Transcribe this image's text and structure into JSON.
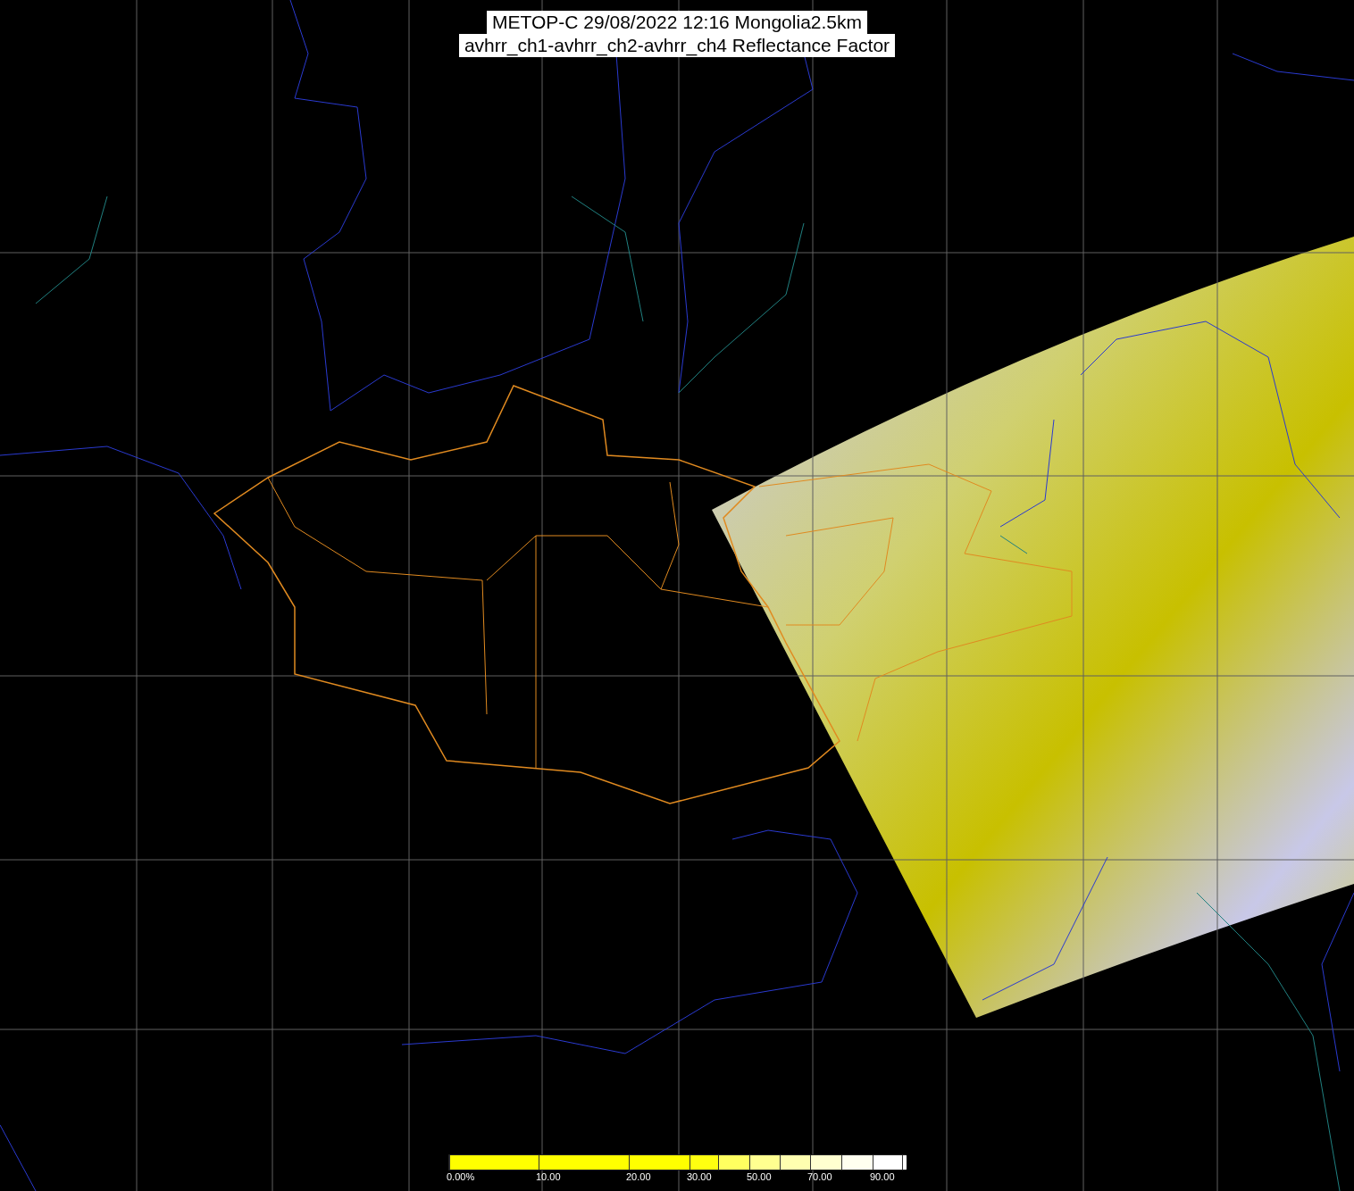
{
  "title": {
    "lines": [
      "METOP-C 29/08/2022 12:16 Mongolia2.5km",
      "avhrr_ch1-avhrr_ch2-avhrr_ch4 Reflectance Factor"
    ]
  },
  "colorbar": {
    "segments": [
      {
        "color": "#ffff00",
        "label": "0.00%"
      },
      {
        "color": "#ffff00",
        "label": "10.00"
      },
      {
        "color": "#ffff00",
        "label": "20.00"
      },
      {
        "color": "#ffff10",
        "label": "30.00"
      },
      {
        "color": "#ffff60"
      },
      {
        "color": "#ffff90",
        "label": "50.00"
      },
      {
        "color": "#ffffb0"
      },
      {
        "color": "#ffffd0",
        "label": "70.00"
      },
      {
        "color": "#fffff0"
      },
      {
        "color": "#ffffff",
        "label": "90.00"
      },
      {
        "color": "#ffffff"
      }
    ]
  }
}
